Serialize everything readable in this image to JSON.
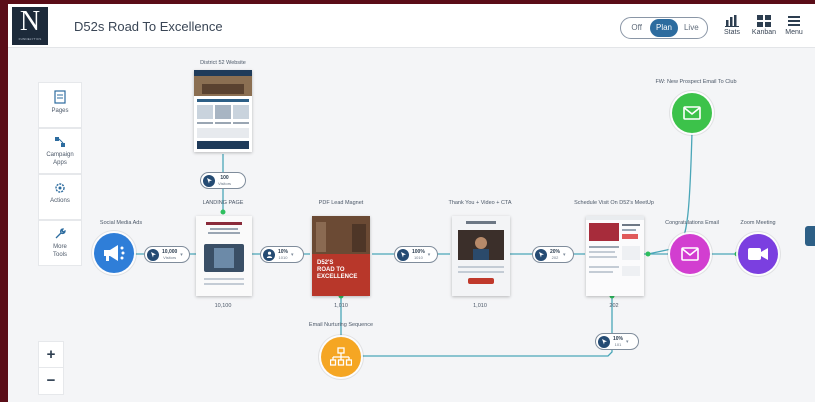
{
  "app": {
    "logo_letter": "N",
    "logo_sub": "FUNNELYTICS",
    "title": "D52s Road To Excellence"
  },
  "mode_toggle": {
    "options": [
      "Off",
      "Plan",
      "Live"
    ],
    "active": "Plan"
  },
  "toolbar": {
    "stats": "Stats",
    "kanban": "Kanban",
    "menu": "Menu"
  },
  "sidebar": {
    "pages": "Pages",
    "campaign_apps_1": "Campaign",
    "campaign_apps_2": "Apps",
    "actions": "Actions",
    "more_tools_1": "More",
    "more_tools_2": "Tools"
  },
  "zoom": {
    "in": "+",
    "out": "−"
  },
  "nodes": {
    "district_website": "District 52 Website",
    "social_media_ads": "Social Media Ads",
    "landing_page": "LANDING PAGE",
    "landing_page_count": "10,100",
    "pdf_lead_magnet": "PDF Lead Magnet",
    "pdf_count": "1,010",
    "pdf_cover_line1": "D52'S",
    "pdf_cover_line2": "ROAD TO",
    "pdf_cover_line3": "EXCELLENCE",
    "thank_you": "Thank You + Video + CTA",
    "thank_you_count": "1,010",
    "schedule_visit": "Schedule Visit On D52's MeetUp",
    "schedule_count": "202",
    "fw_email": "FW: New Prospect Email To Club",
    "congrats_email": "Congratulations Email",
    "zoom_meeting": "Zoom Meeting",
    "email_nurturing": "Email Nurturing Sequence"
  },
  "pills": {
    "website": {
      "a": "100",
      "b": "Visitors"
    },
    "social": {
      "a": "10,000",
      "b": "Visitors"
    },
    "landing": {
      "a": "10%",
      "b": "1010"
    },
    "pdf": {
      "a": "100%",
      "b": "1010"
    },
    "thank_you": {
      "a": "20%",
      "b": "202"
    },
    "nurture": {
      "a": "10%",
      "b": "101"
    }
  },
  "colors": {
    "brand_dark": "#1d2a3a",
    "accent_blue": "#2d6c9f",
    "social_blue": "#2f7ed8",
    "email_green": "#3cc24a",
    "email_magenta": "#d23ed0",
    "zoom_purple": "#7b3fe0",
    "nurture_orange": "#f5a623",
    "connector_teal": "#4aa6b8"
  }
}
